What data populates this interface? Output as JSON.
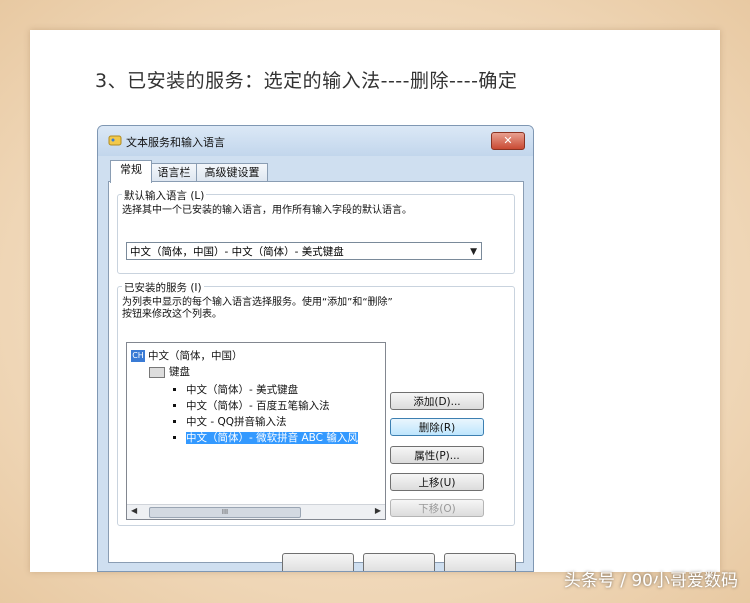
{
  "heading": "3、已安装的服务：选定的输入法----删除----确定",
  "window": {
    "title": "文本服务和输入语言",
    "close_label": "✕"
  },
  "tabs": [
    "常规",
    "语言栏",
    "高级键设置"
  ],
  "default_lang": {
    "label": "默认输入语言 (L)",
    "desc": "选择其中一个已安装的输入语言，用作所有输入字段的默认语言。",
    "selected": "中文（简体，中国）- 中文（简体）- 美式键盘"
  },
  "installed": {
    "label": "已安装的服务 (I)",
    "desc_line1": "为列表中显示的每个输入语言选择服务。使用“添加”和“删除”",
    "desc_line2": "按钮来修改这个列表。",
    "lang_badge": "CH",
    "lang_name": "中文（简体，中国）",
    "category": "键盘",
    "items": [
      "中文（简体）- 美式键盘",
      "中文（简体）- 百度五笔输入法",
      "中文 - QQ拼音输入法",
      "中文（简体）- 微软拼音 ABC 输入风"
    ],
    "scroll_thumb": "III",
    "scroll_left": "◀",
    "scroll_right": "▶"
  },
  "buttons": {
    "add": "添加(D)...",
    "remove": "删除(R)",
    "properties": "属性(P)...",
    "move_up": "上移(U)",
    "move_down": "下移(O)"
  },
  "watermark": "头条号 / 90小哥爱数码"
}
